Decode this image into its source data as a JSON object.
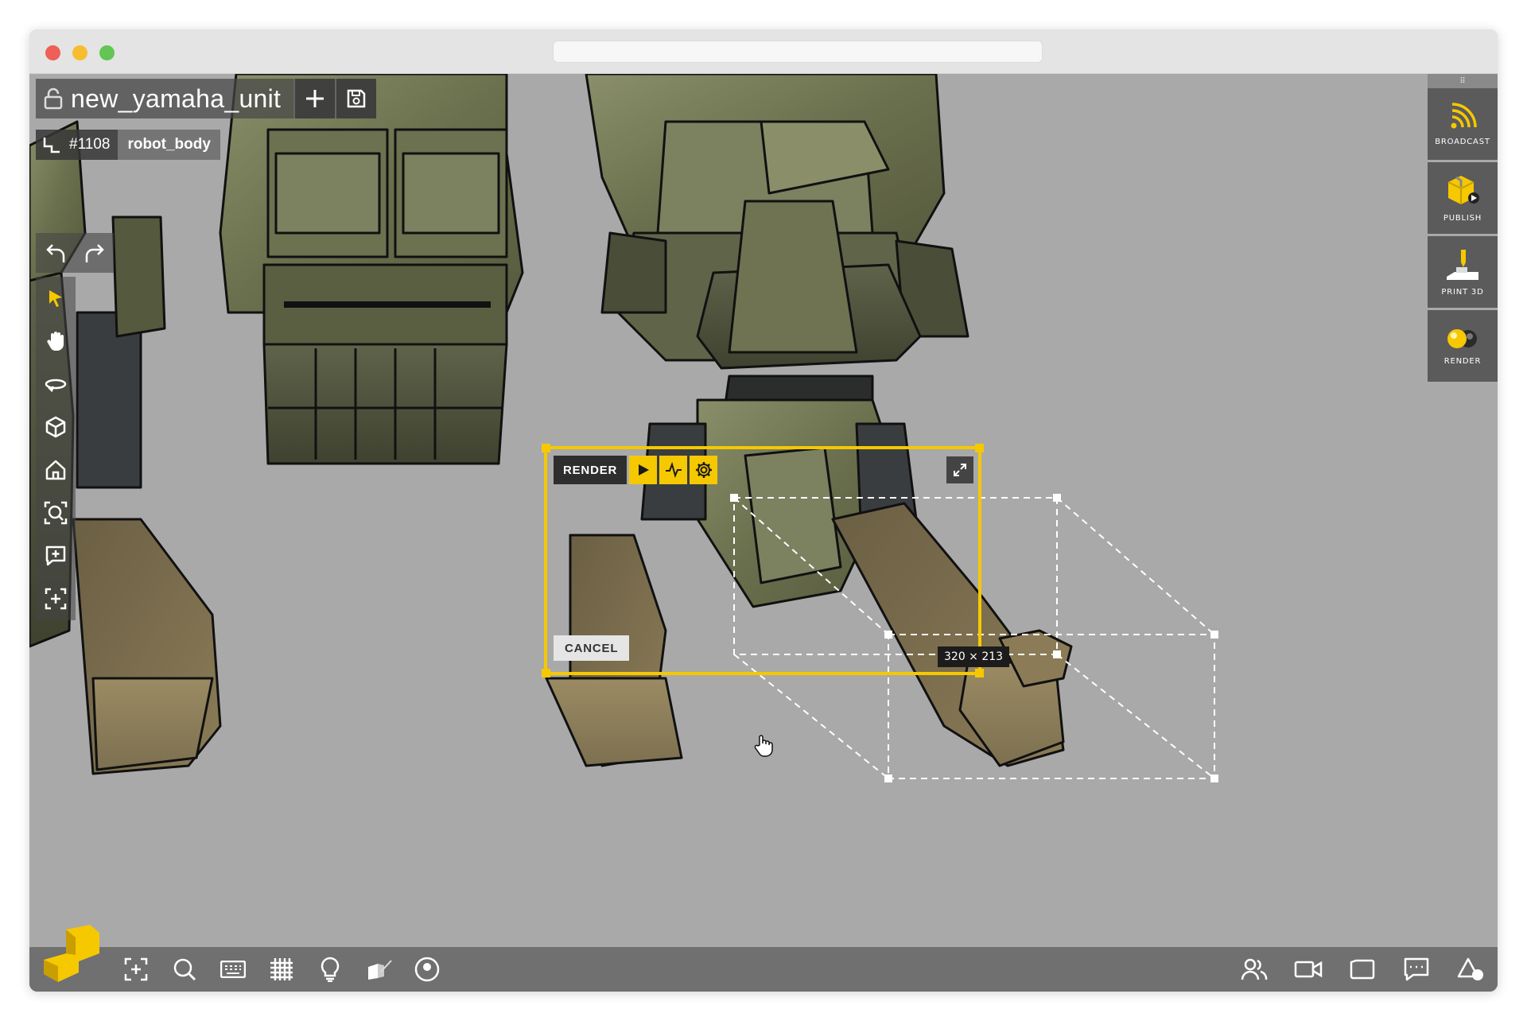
{
  "file": {
    "name": "new_yamaha_unit"
  },
  "breadcrumb": {
    "id": "#1108",
    "name": "robot_body"
  },
  "right_panel": {
    "broadcast": "BROADCAST",
    "publish": "PUBLISH",
    "print3d": "PRINT 3D",
    "render": "RENDER"
  },
  "render_box": {
    "label": "RENDER",
    "cancel": "CANCEL",
    "dimensions": "320 × 213"
  },
  "colors": {
    "accent": "#f5c800",
    "toolbar": "#5b5b5b",
    "viewport": "#a9a9a9"
  }
}
